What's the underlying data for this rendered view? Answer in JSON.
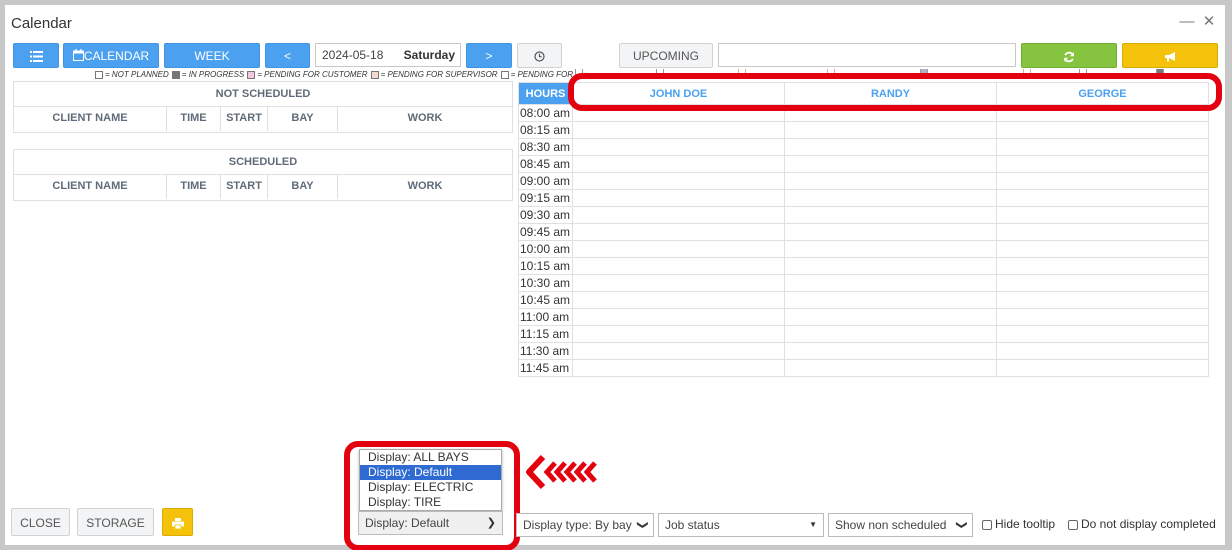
{
  "window": {
    "title": "Calendar"
  },
  "toolbar": {
    "calendar_label": "CALENDAR",
    "week_label": "WEEK",
    "prev_label": "<",
    "next_label": ">",
    "date_value": "2024-05-18",
    "day_label": "Saturday",
    "upcoming_label": "UPCOMING",
    "search_value": ""
  },
  "legend": [
    {
      "label": "= NOT PLANNED",
      "color": "#ffffff"
    },
    {
      "label": "= IN PROGRESS",
      "color": "#777777"
    },
    {
      "label": "= PENDING FOR CUSTOMER",
      "color": "#f3c6e4"
    },
    {
      "label": "= PENDING FOR SUPERVISOR",
      "color": "#f2d9d0"
    },
    {
      "label": "= PENDING FOR PARTS",
      "color": "#ffffff"
    }
  ],
  "not_scheduled": {
    "title": "NOT SCHEDULED",
    "columns": [
      "CLIENT NAME",
      "TIME",
      "START",
      "BAY",
      "WORK"
    ]
  },
  "scheduled": {
    "title": "SCHEDULED",
    "columns": [
      "CLIENT NAME",
      "TIME",
      "START",
      "BAY",
      "WORK"
    ]
  },
  "schedule": {
    "hours_label": "HOURS",
    "employees": [
      "JOHN DOE",
      "RANDY",
      "GEORGE"
    ],
    "times": [
      "08:00 am",
      "08:15 am",
      "08:30 am",
      "08:45 am",
      "09:00 am",
      "09:15 am",
      "09:30 am",
      "09:45 am",
      "10:00 am",
      "10:15 am",
      "10:30 am",
      "10:45 am",
      "11:00 am",
      "11:15 am",
      "11:30 am",
      "11:45 am"
    ]
  },
  "footer": {
    "close_label": "CLOSE",
    "storage_label": "STORAGE",
    "display_selected": "Display: Default",
    "display_options": [
      "Display: ALL BAYS",
      "Display: Default",
      "Display: ELECTRIC",
      "Display: TIRE"
    ],
    "display_type": "Display type: By bay",
    "job_status": "Job status",
    "show_non_scheduled": "Show non scheduled",
    "hide_tooltip_label": "Hide tooltip",
    "no_completed_label": "Do not display completed"
  },
  "colors": {
    "accent_blue": "#4ba1ef",
    "refresh_green": "#86c440",
    "announce_yellow": "#f5c20b",
    "highlight_red": "#e3000f"
  }
}
